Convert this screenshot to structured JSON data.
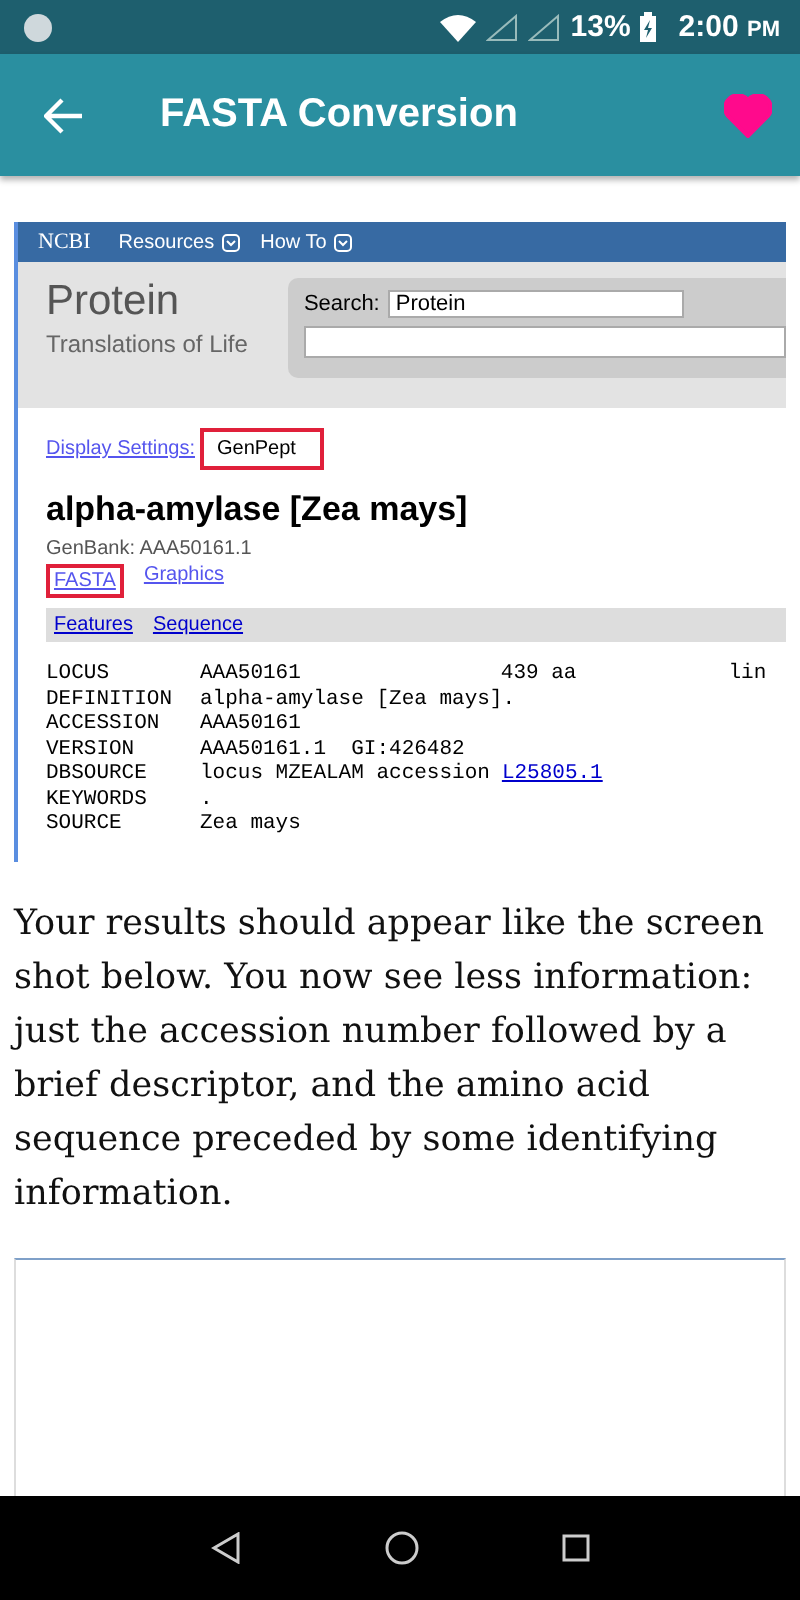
{
  "status_bar": {
    "battery": "13%",
    "time": "2:00",
    "ampm": "PM"
  },
  "app_bar": {
    "title": "FASTA Conversion",
    "favorite": true
  },
  "embedded_page": {
    "nav": [
      "Resources",
      "How To"
    ],
    "logo": "NCBI",
    "db_title": "Protein",
    "db_subtitle": "Translations of Life",
    "search_label": "Search:",
    "search_value": "Protein",
    "display_settings": "Display Settings:",
    "format": "GenPept",
    "record_title": "alpha-amylase [Zea mays]",
    "genbank": "GenBank: AAA50161.1",
    "links": [
      {
        "label": "FASTA",
        "highlighted": true
      },
      {
        "label": "Graphics",
        "highlighted": false
      }
    ],
    "sections": [
      "Features",
      "Sequence"
    ],
    "record_rows": [
      {
        "label": "LOCUS",
        "value": "AAA50161",
        "columns": [
          "439 aa",
          "lin"
        ]
      },
      {
        "label": "DEFINITION",
        "value": "alpha-amylase [Zea mays]."
      },
      {
        "label": "ACCESSION",
        "value": "AAA50161"
      },
      {
        "label": "VERSION",
        "value": "AAA50161.1  GI:426482"
      },
      {
        "label": "DBSOURCE",
        "value": "locus MZEALAM accession",
        "link": "L25805.1"
      },
      {
        "label": "KEYWORDS",
        "value": "."
      },
      {
        "label": "SOURCE",
        "value": "Zea mays"
      }
    ]
  },
  "instructions": "Your results should appear like the screen shot below. You now see less information: just the accession number followed by a brief descriptor, and the amino acid sequence preceded by some identifying information."
}
